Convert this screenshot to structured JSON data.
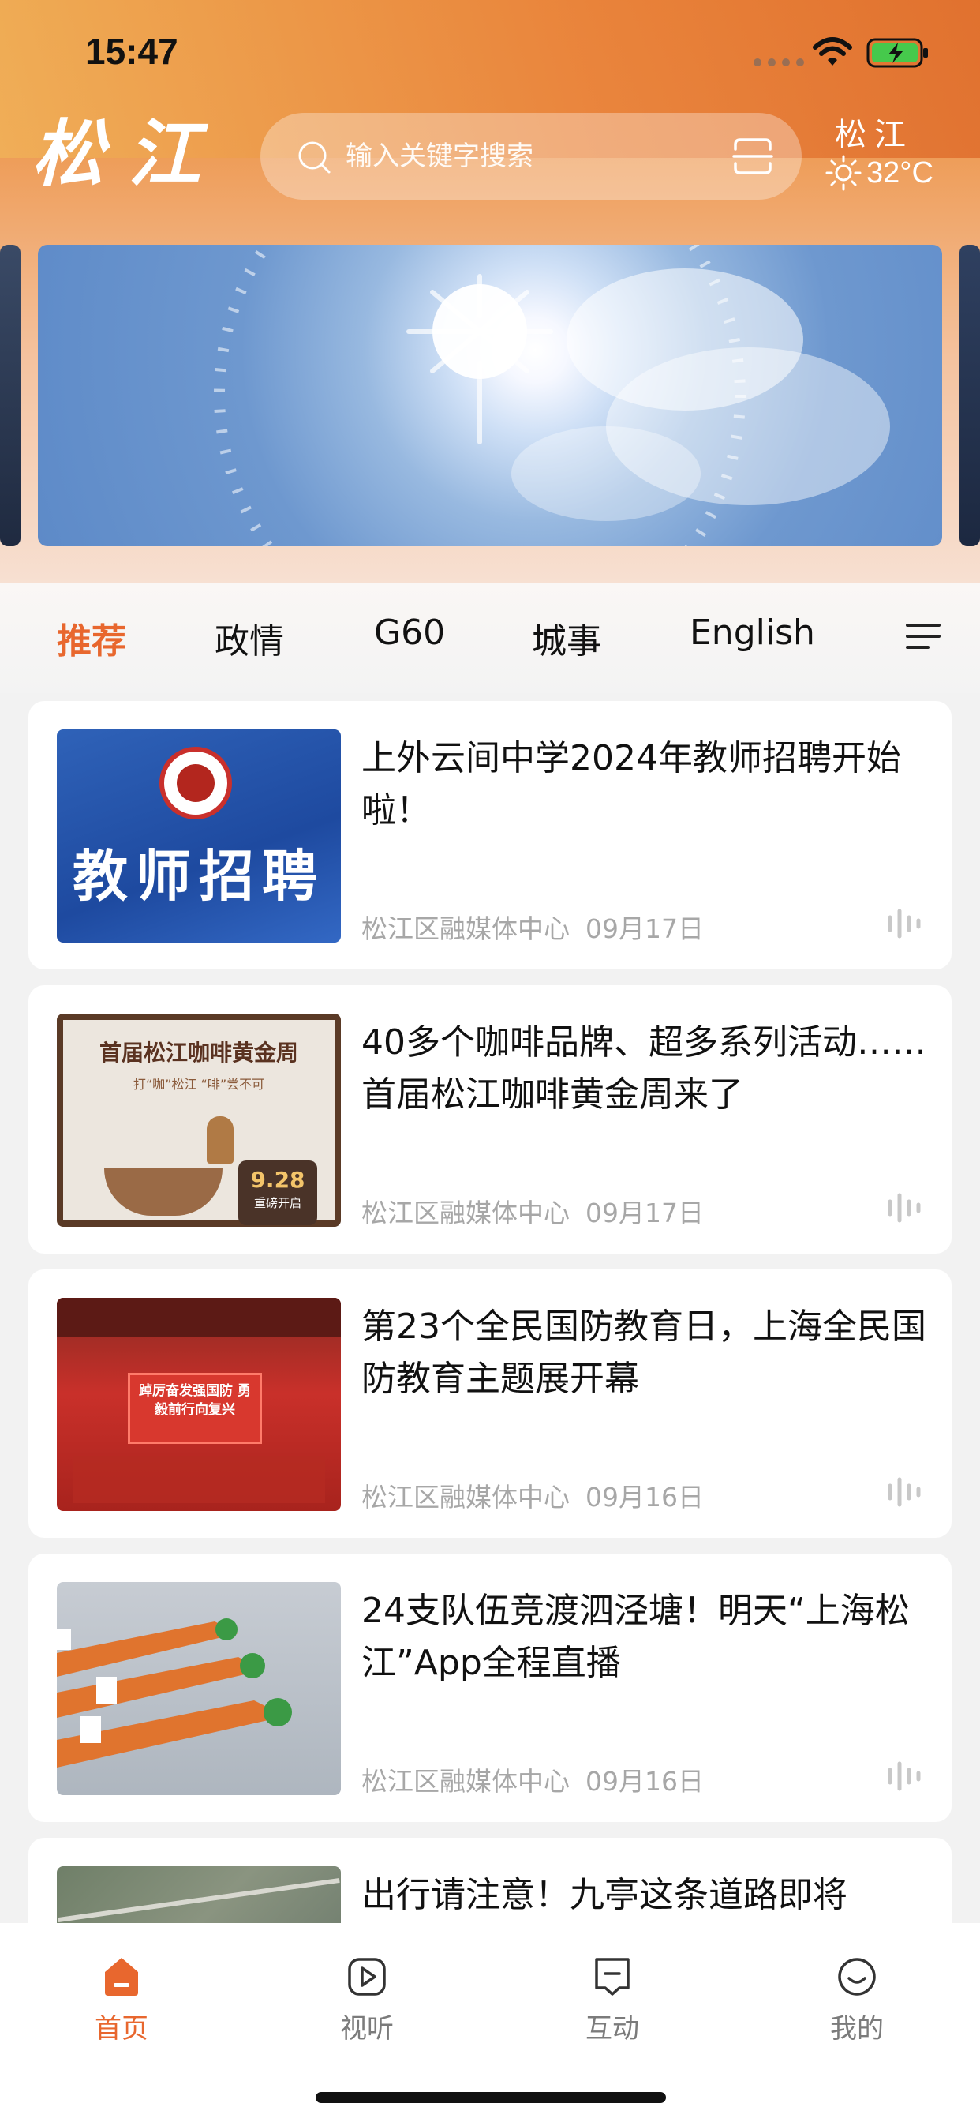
{
  "status": {
    "time": "15:47"
  },
  "header": {
    "logo_text": "松江",
    "search_placeholder": "输入关键字搜索",
    "city": "松江",
    "temperature": "32°C",
    "accent_color": "#e8672e"
  },
  "tabs": [
    {
      "label": "推荐",
      "active": true
    },
    {
      "label": "政情",
      "active": false
    },
    {
      "label": "G60",
      "active": false
    },
    {
      "label": "城事",
      "active": false
    },
    {
      "label": "English",
      "active": false
    }
  ],
  "articles": [
    {
      "title": "上外云间中学2024年教师招聘开始啦！",
      "source": "松江区融媒体中心",
      "date": "09月17日",
      "thumb_text": "教师招聘"
    },
    {
      "title": "40多个咖啡品牌、超多系列活动……首届松江咖啡黄金周来了",
      "source": "松江区融媒体中心",
      "date": "09月17日",
      "thumb_text": "首届松江咖啡黄金周",
      "thumb_subtext": "打“咖”松江 “啡”尝不可",
      "thumb_badge": "9.28",
      "thumb_badge_sub": "重磅开启"
    },
    {
      "title": "第23个全民国防教育日，上海全民国防教育主题展开幕",
      "source": "松江区融媒体中心",
      "date": "09月16日",
      "thumb_text": "踔厉奋发强国防 勇毅前行向复兴"
    },
    {
      "title": "24支队伍竞渡泗泾塘！明天“上海松江”App全程直播",
      "source": "松江区融媒体中心",
      "date": "09月16日"
    },
    {
      "title": "出行请注意！九亭这条道路即将"
    }
  ],
  "bottom_nav": [
    {
      "label": "首页",
      "icon": "home-icon",
      "active": true
    },
    {
      "label": "视听",
      "icon": "play-icon",
      "active": false
    },
    {
      "label": "互动",
      "icon": "chat-icon",
      "active": false
    },
    {
      "label": "我的",
      "icon": "profile-icon",
      "active": false
    }
  ]
}
